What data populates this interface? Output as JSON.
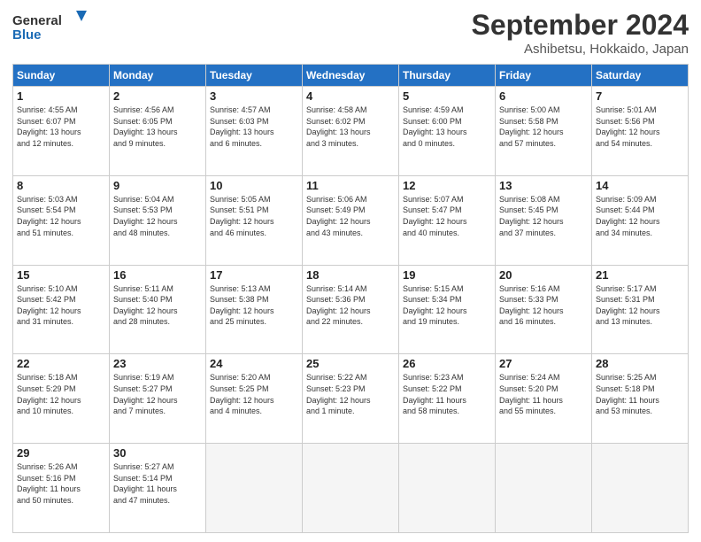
{
  "logo": {
    "line1": "General",
    "line2": "Blue"
  },
  "title": "September 2024",
  "subtitle": "Ashibetsu, Hokkaido, Japan",
  "headers": [
    "Sunday",
    "Monday",
    "Tuesday",
    "Wednesday",
    "Thursday",
    "Friday",
    "Saturday"
  ],
  "weeks": [
    [
      {
        "day": "1",
        "info": "Sunrise: 4:55 AM\nSunset: 6:07 PM\nDaylight: 13 hours\nand 12 minutes."
      },
      {
        "day": "2",
        "info": "Sunrise: 4:56 AM\nSunset: 6:05 PM\nDaylight: 13 hours\nand 9 minutes."
      },
      {
        "day": "3",
        "info": "Sunrise: 4:57 AM\nSunset: 6:03 PM\nDaylight: 13 hours\nand 6 minutes."
      },
      {
        "day": "4",
        "info": "Sunrise: 4:58 AM\nSunset: 6:02 PM\nDaylight: 13 hours\nand 3 minutes."
      },
      {
        "day": "5",
        "info": "Sunrise: 4:59 AM\nSunset: 6:00 PM\nDaylight: 13 hours\nand 0 minutes."
      },
      {
        "day": "6",
        "info": "Sunrise: 5:00 AM\nSunset: 5:58 PM\nDaylight: 12 hours\nand 57 minutes."
      },
      {
        "day": "7",
        "info": "Sunrise: 5:01 AM\nSunset: 5:56 PM\nDaylight: 12 hours\nand 54 minutes."
      }
    ],
    [
      {
        "day": "8",
        "info": "Sunrise: 5:03 AM\nSunset: 5:54 PM\nDaylight: 12 hours\nand 51 minutes."
      },
      {
        "day": "9",
        "info": "Sunrise: 5:04 AM\nSunset: 5:53 PM\nDaylight: 12 hours\nand 48 minutes."
      },
      {
        "day": "10",
        "info": "Sunrise: 5:05 AM\nSunset: 5:51 PM\nDaylight: 12 hours\nand 46 minutes."
      },
      {
        "day": "11",
        "info": "Sunrise: 5:06 AM\nSunset: 5:49 PM\nDaylight: 12 hours\nand 43 minutes."
      },
      {
        "day": "12",
        "info": "Sunrise: 5:07 AM\nSunset: 5:47 PM\nDaylight: 12 hours\nand 40 minutes."
      },
      {
        "day": "13",
        "info": "Sunrise: 5:08 AM\nSunset: 5:45 PM\nDaylight: 12 hours\nand 37 minutes."
      },
      {
        "day": "14",
        "info": "Sunrise: 5:09 AM\nSunset: 5:44 PM\nDaylight: 12 hours\nand 34 minutes."
      }
    ],
    [
      {
        "day": "15",
        "info": "Sunrise: 5:10 AM\nSunset: 5:42 PM\nDaylight: 12 hours\nand 31 minutes."
      },
      {
        "day": "16",
        "info": "Sunrise: 5:11 AM\nSunset: 5:40 PM\nDaylight: 12 hours\nand 28 minutes."
      },
      {
        "day": "17",
        "info": "Sunrise: 5:13 AM\nSunset: 5:38 PM\nDaylight: 12 hours\nand 25 minutes."
      },
      {
        "day": "18",
        "info": "Sunrise: 5:14 AM\nSunset: 5:36 PM\nDaylight: 12 hours\nand 22 minutes."
      },
      {
        "day": "19",
        "info": "Sunrise: 5:15 AM\nSunset: 5:34 PM\nDaylight: 12 hours\nand 19 minutes."
      },
      {
        "day": "20",
        "info": "Sunrise: 5:16 AM\nSunset: 5:33 PM\nDaylight: 12 hours\nand 16 minutes."
      },
      {
        "day": "21",
        "info": "Sunrise: 5:17 AM\nSunset: 5:31 PM\nDaylight: 12 hours\nand 13 minutes."
      }
    ],
    [
      {
        "day": "22",
        "info": "Sunrise: 5:18 AM\nSunset: 5:29 PM\nDaylight: 12 hours\nand 10 minutes."
      },
      {
        "day": "23",
        "info": "Sunrise: 5:19 AM\nSunset: 5:27 PM\nDaylight: 12 hours\nand 7 minutes."
      },
      {
        "day": "24",
        "info": "Sunrise: 5:20 AM\nSunset: 5:25 PM\nDaylight: 12 hours\nand 4 minutes."
      },
      {
        "day": "25",
        "info": "Sunrise: 5:22 AM\nSunset: 5:23 PM\nDaylight: 12 hours\nand 1 minute."
      },
      {
        "day": "26",
        "info": "Sunrise: 5:23 AM\nSunset: 5:22 PM\nDaylight: 11 hours\nand 58 minutes."
      },
      {
        "day": "27",
        "info": "Sunrise: 5:24 AM\nSunset: 5:20 PM\nDaylight: 11 hours\nand 55 minutes."
      },
      {
        "day": "28",
        "info": "Sunrise: 5:25 AM\nSunset: 5:18 PM\nDaylight: 11 hours\nand 53 minutes."
      }
    ],
    [
      {
        "day": "29",
        "info": "Sunrise: 5:26 AM\nSunset: 5:16 PM\nDaylight: 11 hours\nand 50 minutes."
      },
      {
        "day": "30",
        "info": "Sunrise: 5:27 AM\nSunset: 5:14 PM\nDaylight: 11 hours\nand 47 minutes."
      },
      {
        "day": "",
        "info": ""
      },
      {
        "day": "",
        "info": ""
      },
      {
        "day": "",
        "info": ""
      },
      {
        "day": "",
        "info": ""
      },
      {
        "day": "",
        "info": ""
      }
    ]
  ]
}
